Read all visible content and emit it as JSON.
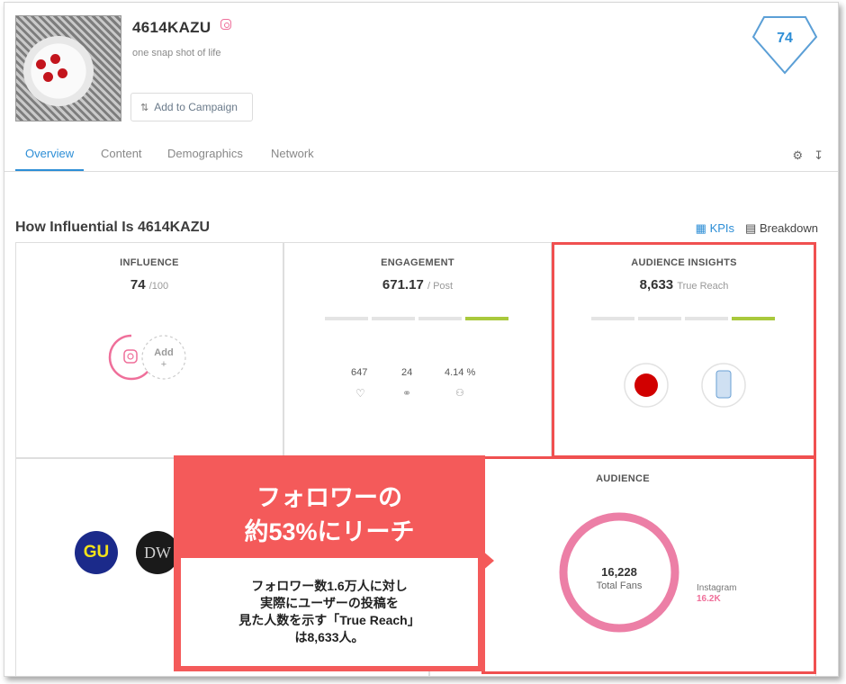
{
  "profile": {
    "username": "4614KAZU",
    "platform_icon": "instagram-icon",
    "tagline": "one snap shot of life",
    "add_campaign_label": "Add to Campaign",
    "score": "74"
  },
  "tabs": [
    {
      "label": "Overview",
      "active": true
    },
    {
      "label": "Content",
      "active": false
    },
    {
      "label": "Demographics",
      "active": false
    },
    {
      "label": "Network",
      "active": false
    }
  ],
  "toolbar_icons": [
    "gear-icon",
    "download-icon"
  ],
  "section": {
    "title": "How Influential Is 4614KAZU",
    "kpis_label": "KPIs",
    "breakdown_label": "Breakdown"
  },
  "influence": {
    "title": "INFLUENCE",
    "value": "74",
    "unit": "/100",
    "add_label": "Add",
    "add_plus": "+"
  },
  "engagement": {
    "title": "ENGAGEMENT",
    "value": "671.17",
    "unit": "/ Post",
    "level_segments": 4,
    "level_filled": 1,
    "likes": "647",
    "comments": "24",
    "rate": "4.14 %"
  },
  "audience_insights": {
    "title": "AUDIENCE INSIGHTS",
    "value": "8,633",
    "unit": "True Reach",
    "level_segments": 4,
    "level_filled": 1
  },
  "brands": {
    "gu": "GU",
    "dw": "DW"
  },
  "audience": {
    "title": "AUDIENCE",
    "total": "16,228",
    "total_label": "Total Fans",
    "platform": "Instagram",
    "platform_count": "16.2K"
  },
  "callout": {
    "heading_line1": "フォロワーの",
    "heading_line2": "約53%にリーチ",
    "body_line1": "フォロワー数1.6万人に対し",
    "body_line2": "実際にユーザーの投稿を",
    "body_line3": "見た人数を示す「True Reach」",
    "body_line4": "は8,633人。"
  },
  "colors": {
    "accent": "#2d8ed6",
    "instagram": "#ef6f9a",
    "highlight": "#f05050",
    "level_on": "#a9c93c"
  }
}
